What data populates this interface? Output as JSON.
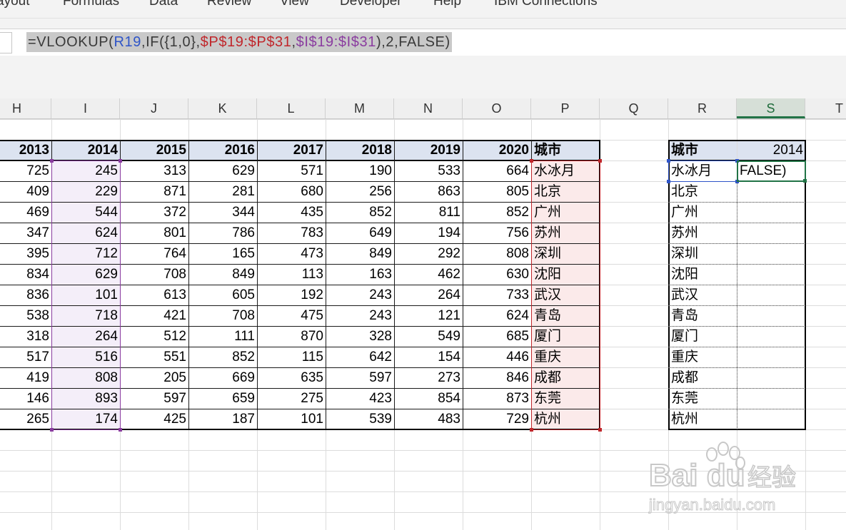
{
  "menu": [
    "ayout",
    "Formulas",
    "Data",
    "Review",
    "View",
    "Developer",
    "Help",
    "IBM Connections"
  ],
  "formula": [
    {
      "text": "=VLOOKUP(",
      "color": "plain"
    },
    {
      "text": "R19",
      "color": "blue"
    },
    {
      "text": ",IF({1,0},",
      "color": "plain"
    },
    {
      "text": "$P$19:$P$31",
      "color": "red"
    },
    {
      "text": ",",
      "color": "plain"
    },
    {
      "text": "$I$19:$I$31",
      "color": "purple"
    },
    {
      "text": "),2,FALSE)",
      "color": "plain"
    }
  ],
  "columns": [
    "H",
    "I",
    "J",
    "K",
    "L",
    "M",
    "N",
    "O",
    "P",
    "Q",
    "R",
    "S",
    "T"
  ],
  "selected_column": "S",
  "table": {
    "year_headers": [
      "2013",
      "2014",
      "2015",
      "2016",
      "2017",
      "2018",
      "2019",
      "2020"
    ],
    "city_header": "城市",
    "rows": [
      {
        "values": [
          "725",
          "245",
          "313",
          "629",
          "571",
          "190",
          "533",
          "664"
        ],
        "city": "水冰月"
      },
      {
        "values": [
          "409",
          "229",
          "871",
          "281",
          "680",
          "256",
          "863",
          "805"
        ],
        "city": "北京"
      },
      {
        "values": [
          "469",
          "544",
          "372",
          "344",
          "435",
          "852",
          "811",
          "852"
        ],
        "city": "广州"
      },
      {
        "values": [
          "347",
          "624",
          "801",
          "786",
          "783",
          "649",
          "194",
          "756"
        ],
        "city": "苏州"
      },
      {
        "values": [
          "395",
          "712",
          "764",
          "165",
          "473",
          "849",
          "292",
          "808"
        ],
        "city": "深圳"
      },
      {
        "values": [
          "834",
          "629",
          "708",
          "849",
          "113",
          "163",
          "462",
          "630"
        ],
        "city": "沈阳"
      },
      {
        "values": [
          "836",
          "101",
          "613",
          "605",
          "192",
          "243",
          "264",
          "733"
        ],
        "city": "武汉"
      },
      {
        "values": [
          "538",
          "718",
          "421",
          "708",
          "475",
          "243",
          "121",
          "624"
        ],
        "city": "青岛"
      },
      {
        "values": [
          "318",
          "264",
          "512",
          "111",
          "870",
          "328",
          "549",
          "685"
        ],
        "city": "厦门"
      },
      {
        "values": [
          "517",
          "516",
          "551",
          "852",
          "115",
          "642",
          "154",
          "446"
        ],
        "city": "重庆"
      },
      {
        "values": [
          "419",
          "808",
          "205",
          "669",
          "635",
          "597",
          "273",
          "846"
        ],
        "city": "成都"
      },
      {
        "values": [
          "146",
          "893",
          "597",
          "659",
          "275",
          "423",
          "854",
          "873"
        ],
        "city": "东莞"
      },
      {
        "values": [
          "265",
          "174",
          "425",
          "187",
          "101",
          "539",
          "483",
          "729"
        ],
        "city": "杭州"
      }
    ]
  },
  "lookup": {
    "city_header": "城市",
    "year_header": "2014",
    "active_cell_text": "FALSE)",
    "cities": [
      "水冰月",
      "北京",
      "广州",
      "苏州",
      "深圳",
      "沈阳",
      "武汉",
      "青岛",
      "厦门",
      "重庆",
      "成都",
      "东莞",
      "杭州"
    ]
  },
  "watermark": {
    "brand": "Bai du",
    "cn": "经验",
    "url": "jingyan.baidu.com"
  },
  "colors": {
    "header_fill": "#dce3f0",
    "purple_range": "#8a3c9f",
    "red_range": "#c0262b",
    "blue_ref": "#2f55c8",
    "active_green": "#217346"
  }
}
